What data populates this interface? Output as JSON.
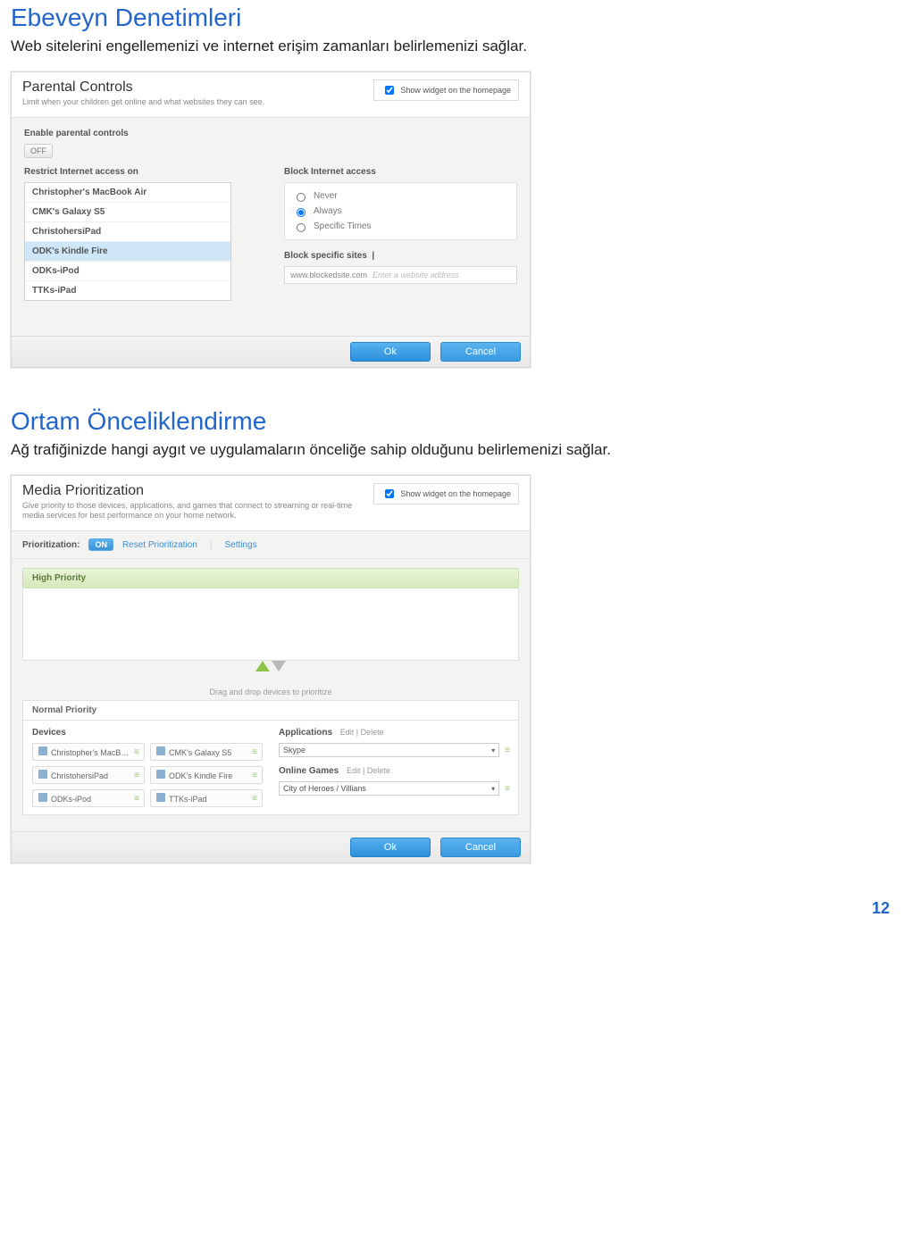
{
  "page_number": "12",
  "section1": {
    "title": "Ebeveyn Denetimleri",
    "desc": "Web sitelerini engellemenizi ve internet erişim zamanları belirlemenizi sağlar."
  },
  "panel1": {
    "title": "Parental Controls",
    "sub": "Limit when your children get online and what websites they can see.",
    "widget_label": "Show widget on the homepage",
    "enable_label": "Enable parental controls",
    "toggle": "OFF",
    "restrict_label": "Restrict Internet access on",
    "devices": [
      "Christopher's MacBook Air",
      "CMK's Galaxy S5",
      "ChristohersiPad",
      "ODK's Kindle Fire",
      "ODKs-iPod",
      "TTKs-iPad"
    ],
    "selected_index": 3,
    "block_label": "Block Internet access",
    "radios": [
      "Never",
      "Always",
      "Specific Times"
    ],
    "radio_selected": 1,
    "sites_label": "Block specific sites",
    "site_value": "www.blockedsite.com",
    "site_hint": "Enter a website address",
    "ok": "Ok",
    "cancel": "Cancel"
  },
  "section2": {
    "title": "Ortam Önceliklendirme",
    "desc": "Ağ trafiğinizde hangi aygıt ve uygulamaların önceliğe sahip olduğunu belirlemenizi sağlar."
  },
  "panel2": {
    "title": "Media Prioritization",
    "sub": "Give priority to those devices, applications, and games that connect to streaming or real-time media services for best performance on your home network.",
    "widget_label": "Show widget on the homepage",
    "prioritization_label": "Prioritization:",
    "toggle": "ON",
    "reset": "Reset Prioritization",
    "settings": "Settings",
    "high_label": "High Priority",
    "drag_hint": "Drag and drop devices to prioritize",
    "normal_label": "Normal Priority",
    "devices_label": "Devices",
    "devices": [
      "Christopher's MacB…",
      "CMK's Galaxy S5",
      "ChristohersiPad",
      "ODK's Kindle Fire",
      "ODKs-iPod",
      "TTKs-iPad"
    ],
    "apps_label": "Applications",
    "apps_links": "Edit   |   Delete",
    "app_sel": "Skype",
    "games_label": "Online Games",
    "games_links": "Edit   |   Delete",
    "game_sel": "City of Heroes / Villians",
    "ok": "Ok",
    "cancel": "Cancel"
  }
}
